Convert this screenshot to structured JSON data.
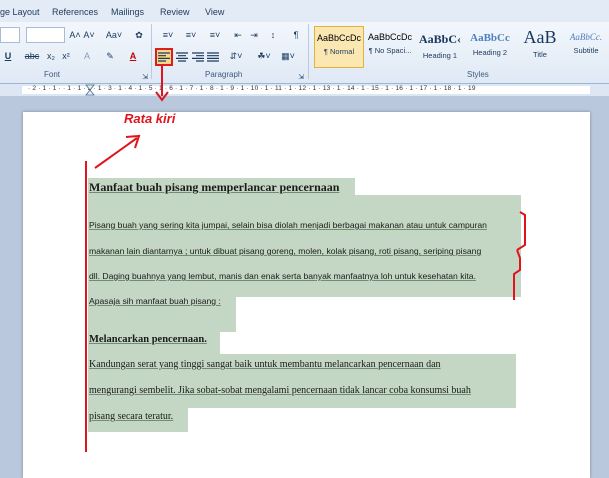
{
  "tabs": [
    "ge Layout",
    "References",
    "Mailings",
    "Review",
    "View"
  ],
  "font_group": {
    "label": "Font",
    "grow_font": "A˄",
    "shrink_font": "A˅",
    "change_case": "Aa˅",
    "underline": "U",
    "strikethrough": "abc",
    "subscript": "x₂",
    "superscript": "x²",
    "text_effects": "A",
    "font_color": "A"
  },
  "paragraph_group": {
    "label": "Paragraph",
    "pilcrow": "¶",
    "sort": "↕"
  },
  "styles_group": {
    "label": "Styles",
    "items": [
      {
        "sample": "AaBbCcDc",
        "name": "¶ Normal"
      },
      {
        "sample": "AaBbCcDc",
        "name": "¶ No Spaci..."
      },
      {
        "sample": "AaBbC‹",
        "name": "Heading 1"
      },
      {
        "sample": "AaBbCc",
        "name": "Heading 2"
      },
      {
        "sample": "AaB",
        "name": "Title"
      },
      {
        "sample": "AaBbCc.",
        "name": "Subtitle"
      }
    ]
  },
  "ruler_text": "· 2 · 1 · 1 · · 1 · 1 · 2 · 1 · 3 · 1 · 4 · 1 · 5 · 1 · 6 · 1 · 7 · 1 · 8 · 1 · 9 · 1 · 10 · 1 · 11 · 1 · 12 · 1 · 13 · 1 · 14 · 1 · 15 · 1 · 16 · 1 · 17 · 1 · 18 · 1 · 19",
  "annotation": "Rata kiri",
  "document": {
    "heading1": "Manfaat buah pisang memperlancar pencernaan",
    "para1": [
      "Pisang buah yang sering kita jumpai, selain bisa diolah menjadi berbagai makanan atau untuk campuran",
      "makanan lain diantarnya ; untuk dibuat pisang goreng, molen, kolak pisang, roti pisang, seriping pisang",
      "dll. Daging buahnya yang lembut, manis dan enak serta banyak manfaatnya loh untuk kesehatan kita.",
      "Apasaja sih manfaat buah pisang :"
    ],
    "heading2": "Melancarkan pencernaan.",
    "para2": [
      "Kandungan serat yang tinggi sangat baik untuk membantu melancarkan pencernaan dan",
      "mengurangi sembelit.  Jika sobat-sobat mengalami pencernaan tidak lancar coba konsumsi buah",
      "pisang secara teratur."
    ]
  },
  "colors": {
    "annotation": "#e0141e",
    "highlight": "#c4d7c4",
    "ribbon": "#dfe9f5"
  }
}
